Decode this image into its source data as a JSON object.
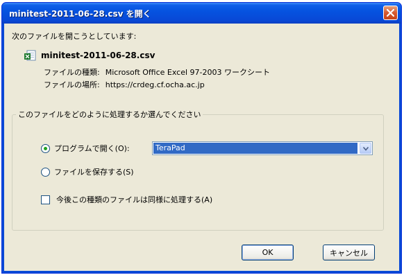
{
  "window": {
    "title": "minitest-2011-06-28.csv を開く"
  },
  "dialog": {
    "prompt": "次のファイルを開こうとしています:",
    "file_name": "minitest-2011-06-28.csv",
    "file_type_label": "ファイルの種類:",
    "file_type_value": "Microsoft Office Excel 97-2003 ワークシート",
    "file_location_label": "ファイルの場所:",
    "file_location_value": "https://crdeg.cf.ocha.ac.jp"
  },
  "group": {
    "legend": "このファイルをどのように処理するか選んでください",
    "open_with_label": "プログラムで開く(O):",
    "open_with_selected": true,
    "program_value": "TeraPad",
    "save_label": "ファイルを保存する(S)",
    "save_selected": false,
    "remember_label": "今後この種類のファイルは同様に処理する(A)",
    "remember_checked": false
  },
  "buttons": {
    "ok": "OK",
    "cancel": "キャンセル"
  },
  "colors": {
    "titlebar": "#0a4ad6",
    "client": "#ece9d8",
    "close_button": "#d7592f",
    "selection": "#316ac5",
    "radio_dot": "#21a121"
  },
  "icons": {
    "file": "excel-file-icon",
    "close": "close-icon",
    "dropdown": "chevron-down-icon"
  }
}
